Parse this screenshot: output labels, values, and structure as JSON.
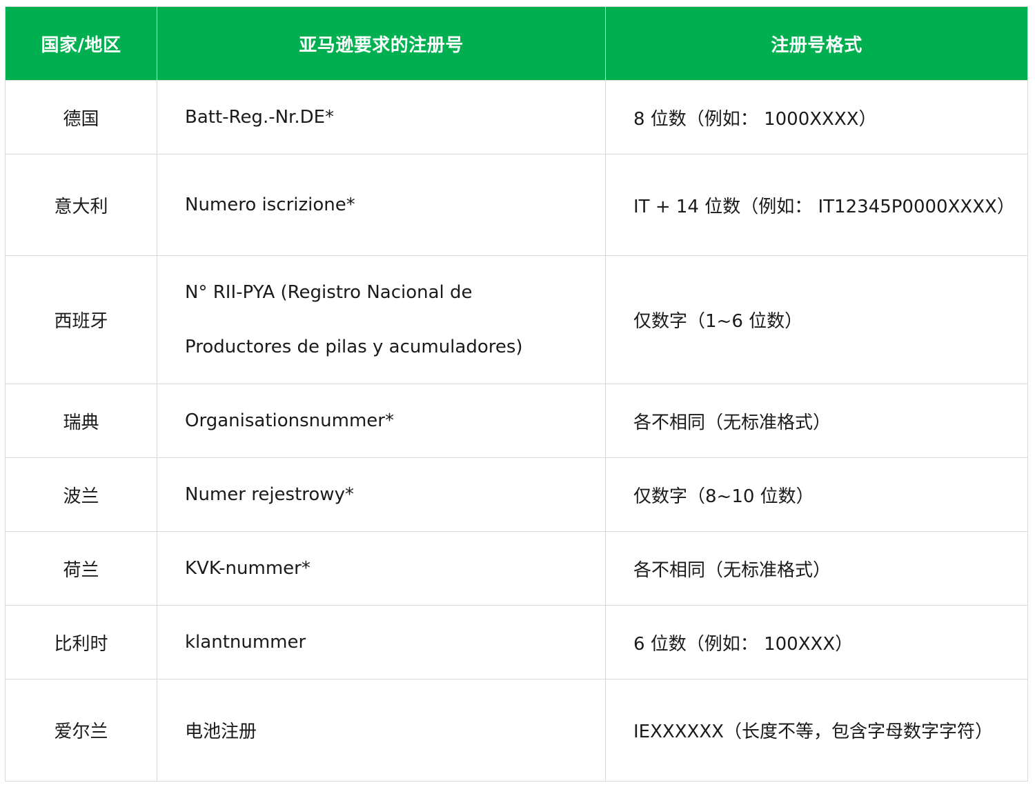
{
  "table": {
    "headers": [
      "国家/地区",
      "亚马逊要求的注册号",
      "注册号格式"
    ],
    "rows": [
      {
        "country": "德国",
        "reg_lines": [
          "Batt-Reg.-Nr.DE*"
        ],
        "format": "8 位数（例如： 1000XXXX）"
      },
      {
        "country": "意大利",
        "reg_lines": [
          "Numero iscrizione*"
        ],
        "format": "IT + 14 位数（例如： IT12345P0000XXXX）"
      },
      {
        "country": "西班牙",
        "reg_lines": [
          "N° RII-PYA (Registro Nacional de",
          "Productores de pilas y acumuladores)"
        ],
        "format": "仅数字（1~6 位数）"
      },
      {
        "country": "瑞典",
        "reg_lines": [
          "Organisationsnummer*"
        ],
        "format": "各不相同（无标准格式）"
      },
      {
        "country": "波兰",
        "reg_lines": [
          "Numer rejestrowy*"
        ],
        "format": "仅数字（8~10 位数）"
      },
      {
        "country": "荷兰",
        "reg_lines": [
          "KVK-nummer*"
        ],
        "format": "各不相同（无标准格式）"
      },
      {
        "country": "比利时",
        "reg_lines": [
          "klantnummer"
        ],
        "format": "6 位数（例如： 100XXX）"
      },
      {
        "country": "爱尔兰",
        "reg_lines": [
          "电池注册"
        ],
        "format": "IEXXXXXX（长度不等，包含字母数字字符）"
      }
    ]
  },
  "colors": {
    "header_bg": "#00b050",
    "header_text": "#ffffff",
    "border": "#d9d9d9",
    "body_text": "#1a1a1a"
  }
}
